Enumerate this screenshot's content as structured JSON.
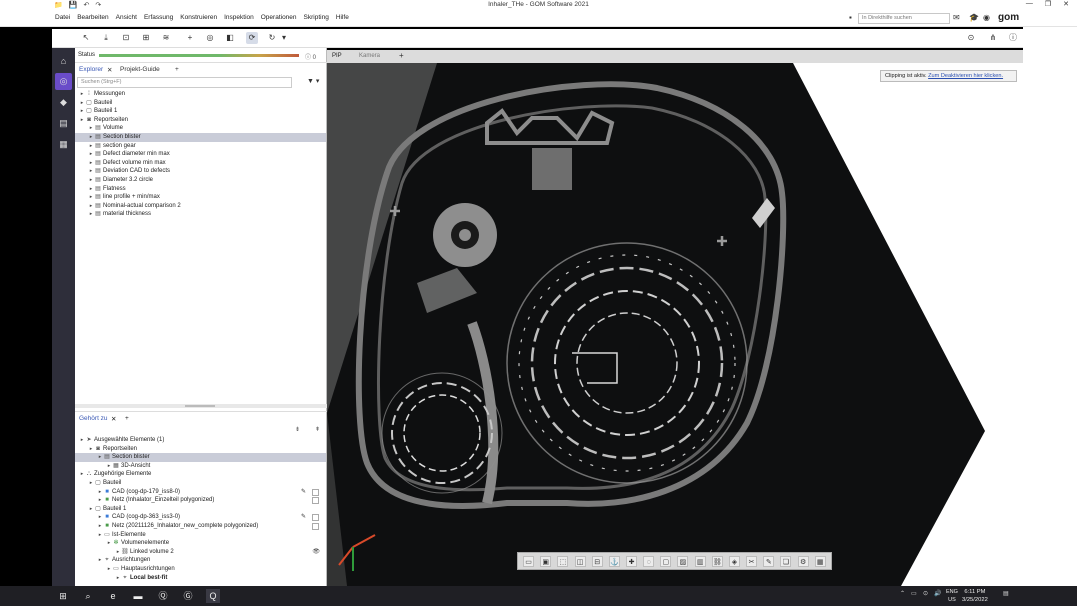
{
  "window": {
    "title": "Inhaler_THe - GOM Software 2021",
    "controls": [
      "—",
      "❐",
      "✕"
    ]
  },
  "menubar": {
    "items": [
      "Datei",
      "Bearbeiten",
      "Ansicht",
      "Erfassung",
      "Konstruieren",
      "Inspektion",
      "Operationen",
      "Skripting",
      "Hilfe"
    ],
    "help_search_placeholder": "In Direkthilfe suchen",
    "logo": "gom"
  },
  "left_strip": {
    "icons": [
      "home-icon",
      "target-icon",
      "cube-icon",
      "report-icon",
      "apps-icon"
    ]
  },
  "explorer": {
    "status_label": "Status",
    "status_count": "0",
    "tabs": [
      "Explorer",
      "Projekt-Guide"
    ],
    "search_placeholder": "Suchen (Strg+F)",
    "tree": [
      {
        "label": "Messungen",
        "level": 0,
        "icon": "measure"
      },
      {
        "label": "Bauteil",
        "level": 0,
        "icon": "part"
      },
      {
        "label": "Bauteil 1",
        "level": 0,
        "icon": "part"
      },
      {
        "label": "Reportseiten",
        "level": 0,
        "icon": "camera",
        "open": true
      },
      {
        "label": "Volume",
        "level": 1,
        "icon": "page"
      },
      {
        "label": "Section blister",
        "level": 1,
        "icon": "page",
        "selected": true
      },
      {
        "label": "section gear",
        "level": 1,
        "icon": "page"
      },
      {
        "label": "Defect diameter min max",
        "level": 1,
        "icon": "page"
      },
      {
        "label": "Defect volume min max",
        "level": 1,
        "icon": "page"
      },
      {
        "label": "Deviation CAD to defects",
        "level": 1,
        "icon": "page"
      },
      {
        "label": "Diameter 3.2 circle",
        "level": 1,
        "icon": "page"
      },
      {
        "label": "Flatness",
        "level": 1,
        "icon": "page"
      },
      {
        "label": "line profile + min/max",
        "level": 1,
        "icon": "page"
      },
      {
        "label": "Nominal-actual comparison 2",
        "level": 1,
        "icon": "page"
      },
      {
        "label": "material thickness",
        "level": 1,
        "icon": "page"
      }
    ]
  },
  "belongs": {
    "tab": "Gehört zu",
    "tree": [
      {
        "label": "Ausgewählte Elemente (1)",
        "level": 0,
        "icon": "cursor"
      },
      {
        "label": "Reportseiten",
        "level": 1,
        "icon": "camera"
      },
      {
        "label": "Section blister",
        "level": 2,
        "icon": "page",
        "selected": true
      },
      {
        "label": "3D-Ansicht",
        "level": 3,
        "icon": "grid"
      },
      {
        "label": "Zugehörige Elemente",
        "level": 0,
        "icon": "group"
      },
      {
        "label": "Bauteil",
        "level": 1,
        "icon": "part"
      },
      {
        "label": "CAD (cog-dp-179_iss8-0)",
        "level": 2,
        "icon": "cad",
        "edit": true
      },
      {
        "label": "Netz (Inhalator_Einzelteil polygonized)",
        "level": 2,
        "icon": "mesh",
        "edit": false
      },
      {
        "label": "Bauteil 1",
        "level": 1,
        "icon": "part"
      },
      {
        "label": "CAD (cog-dp-363_iss3-0)",
        "level": 2,
        "icon": "cad",
        "edit": true
      },
      {
        "label": "Netz (20211126_Inhalator_new_complete polygonized)",
        "level": 2,
        "icon": "mesh",
        "edit": false
      },
      {
        "label": "Ist-Elemente",
        "level": 2,
        "icon": "folder"
      },
      {
        "label": "Volumenelemente",
        "level": 3,
        "icon": "volume"
      },
      {
        "label": "Linked volume 2",
        "level": 4,
        "icon": "link",
        "eye": true
      },
      {
        "label": "Ausrichtungen",
        "level": 2,
        "icon": "align"
      },
      {
        "label": "Hauptausrichtungen",
        "level": 3,
        "icon": "folder"
      },
      {
        "label": "Local best-fit",
        "level": 4,
        "icon": "align",
        "bold": true
      }
    ]
  },
  "viewport": {
    "tabs": [
      "PIP",
      "Kamera"
    ],
    "clip_text": "Clipping ist aktiv.",
    "clip_link": "Zum Deaktivieren hier klicken."
  },
  "taskbar": {
    "tray_lang_1": "ENG",
    "tray_lang_2": "US",
    "time": "6:11 PM",
    "date": "3/25/2022"
  },
  "colors": {
    "accent_purple": "#6a4cc9",
    "selection": "#c9ccd8",
    "link_blue": "#2a4fb0"
  }
}
